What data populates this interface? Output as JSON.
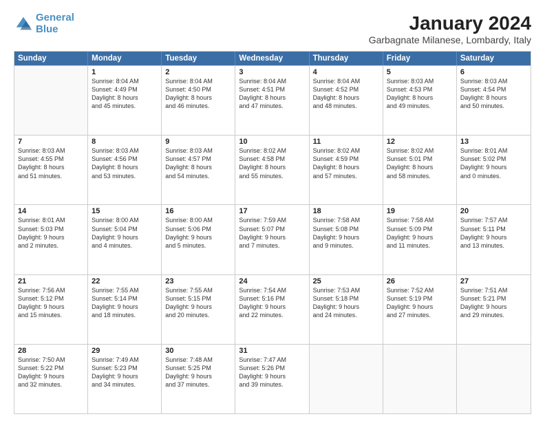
{
  "header": {
    "logo_line1": "General",
    "logo_line2": "Blue",
    "title": "January 2024",
    "subtitle": "Garbagnate Milanese, Lombardy, Italy"
  },
  "calendar": {
    "days_of_week": [
      "Sunday",
      "Monday",
      "Tuesday",
      "Wednesday",
      "Thursday",
      "Friday",
      "Saturday"
    ],
    "weeks": [
      [
        {
          "day": "",
          "info": ""
        },
        {
          "day": "1",
          "info": "Sunrise: 8:04 AM\nSunset: 4:49 PM\nDaylight: 8 hours\nand 45 minutes."
        },
        {
          "day": "2",
          "info": "Sunrise: 8:04 AM\nSunset: 4:50 PM\nDaylight: 8 hours\nand 46 minutes."
        },
        {
          "day": "3",
          "info": "Sunrise: 8:04 AM\nSunset: 4:51 PM\nDaylight: 8 hours\nand 47 minutes."
        },
        {
          "day": "4",
          "info": "Sunrise: 8:04 AM\nSunset: 4:52 PM\nDaylight: 8 hours\nand 48 minutes."
        },
        {
          "day": "5",
          "info": "Sunrise: 8:03 AM\nSunset: 4:53 PM\nDaylight: 8 hours\nand 49 minutes."
        },
        {
          "day": "6",
          "info": "Sunrise: 8:03 AM\nSunset: 4:54 PM\nDaylight: 8 hours\nand 50 minutes."
        }
      ],
      [
        {
          "day": "7",
          "info": "Sunrise: 8:03 AM\nSunset: 4:55 PM\nDaylight: 8 hours\nand 51 minutes."
        },
        {
          "day": "8",
          "info": "Sunrise: 8:03 AM\nSunset: 4:56 PM\nDaylight: 8 hours\nand 53 minutes."
        },
        {
          "day": "9",
          "info": "Sunrise: 8:03 AM\nSunset: 4:57 PM\nDaylight: 8 hours\nand 54 minutes."
        },
        {
          "day": "10",
          "info": "Sunrise: 8:02 AM\nSunset: 4:58 PM\nDaylight: 8 hours\nand 55 minutes."
        },
        {
          "day": "11",
          "info": "Sunrise: 8:02 AM\nSunset: 4:59 PM\nDaylight: 8 hours\nand 57 minutes."
        },
        {
          "day": "12",
          "info": "Sunrise: 8:02 AM\nSunset: 5:01 PM\nDaylight: 8 hours\nand 58 minutes."
        },
        {
          "day": "13",
          "info": "Sunrise: 8:01 AM\nSunset: 5:02 PM\nDaylight: 9 hours\nand 0 minutes."
        }
      ],
      [
        {
          "day": "14",
          "info": "Sunrise: 8:01 AM\nSunset: 5:03 PM\nDaylight: 9 hours\nand 2 minutes."
        },
        {
          "day": "15",
          "info": "Sunrise: 8:00 AM\nSunset: 5:04 PM\nDaylight: 9 hours\nand 4 minutes."
        },
        {
          "day": "16",
          "info": "Sunrise: 8:00 AM\nSunset: 5:06 PM\nDaylight: 9 hours\nand 5 minutes."
        },
        {
          "day": "17",
          "info": "Sunrise: 7:59 AM\nSunset: 5:07 PM\nDaylight: 9 hours\nand 7 minutes."
        },
        {
          "day": "18",
          "info": "Sunrise: 7:58 AM\nSunset: 5:08 PM\nDaylight: 9 hours\nand 9 minutes."
        },
        {
          "day": "19",
          "info": "Sunrise: 7:58 AM\nSunset: 5:09 PM\nDaylight: 9 hours\nand 11 minutes."
        },
        {
          "day": "20",
          "info": "Sunrise: 7:57 AM\nSunset: 5:11 PM\nDaylight: 9 hours\nand 13 minutes."
        }
      ],
      [
        {
          "day": "21",
          "info": "Sunrise: 7:56 AM\nSunset: 5:12 PM\nDaylight: 9 hours\nand 15 minutes."
        },
        {
          "day": "22",
          "info": "Sunrise: 7:55 AM\nSunset: 5:14 PM\nDaylight: 9 hours\nand 18 minutes."
        },
        {
          "day": "23",
          "info": "Sunrise: 7:55 AM\nSunset: 5:15 PM\nDaylight: 9 hours\nand 20 minutes."
        },
        {
          "day": "24",
          "info": "Sunrise: 7:54 AM\nSunset: 5:16 PM\nDaylight: 9 hours\nand 22 minutes."
        },
        {
          "day": "25",
          "info": "Sunrise: 7:53 AM\nSunset: 5:18 PM\nDaylight: 9 hours\nand 24 minutes."
        },
        {
          "day": "26",
          "info": "Sunrise: 7:52 AM\nSunset: 5:19 PM\nDaylight: 9 hours\nand 27 minutes."
        },
        {
          "day": "27",
          "info": "Sunrise: 7:51 AM\nSunset: 5:21 PM\nDaylight: 9 hours\nand 29 minutes."
        }
      ],
      [
        {
          "day": "28",
          "info": "Sunrise: 7:50 AM\nSunset: 5:22 PM\nDaylight: 9 hours\nand 32 minutes."
        },
        {
          "day": "29",
          "info": "Sunrise: 7:49 AM\nSunset: 5:23 PM\nDaylight: 9 hours\nand 34 minutes."
        },
        {
          "day": "30",
          "info": "Sunrise: 7:48 AM\nSunset: 5:25 PM\nDaylight: 9 hours\nand 37 minutes."
        },
        {
          "day": "31",
          "info": "Sunrise: 7:47 AM\nSunset: 5:26 PM\nDaylight: 9 hours\nand 39 minutes."
        },
        {
          "day": "",
          "info": ""
        },
        {
          "day": "",
          "info": ""
        },
        {
          "day": "",
          "info": ""
        }
      ]
    ]
  }
}
